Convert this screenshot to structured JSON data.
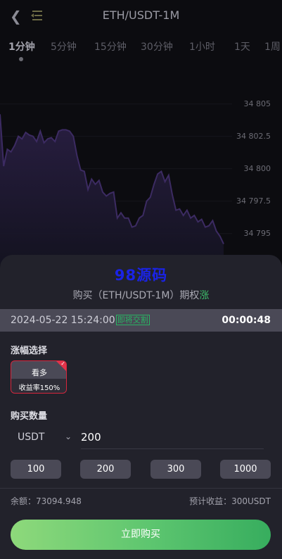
{
  "header": {
    "back_icon": "chevron-left-icon",
    "menu_icon": "menu-collapse-icon",
    "title": "ETH/USDT-1M"
  },
  "intervals": [
    "1分钟",
    "5分钟",
    "15分钟",
    "30分钟",
    "1小时",
    "1天",
    "1周"
  ],
  "active_interval": "1分钟",
  "chart_data": {
    "type": "area",
    "y_tick_labels": [
      "34 805",
      "34 802.5",
      "34 800",
      "34 797.5",
      "34 795"
    ],
    "ylim": [
      34792.6,
      34807.8
    ],
    "line_color": "#3c2b62",
    "values": [
      34804.2,
      34800.2,
      34801.5,
      34801.3,
      34801.8,
      34802.5,
      34802.3,
      34802.8,
      34802.6,
      34802.5,
      34802.1,
      34802.9,
      34802.0,
      34802.3,
      34802.4,
      34802.1,
      34802.9,
      34803.0,
      34803.0,
      34802.9,
      34802.5,
      34801.0,
      34799.9,
      34799.8,
      34798.4,
      34799.2,
      34798.8,
      34799.1,
      34798.2,
      34797.9,
      34798.1,
      34798.2,
      34796.2,
      34796.6,
      34796.2,
      34796.2,
      34795.5,
      34795.6,
      34796.2,
      34796.4,
      34797.5,
      34797.8,
      34798.8,
      34799.6,
      34799.8,
      34799.0,
      34799.5,
      34798.0,
      34796.8,
      34796.9,
      34796.4,
      34796.8,
      34796.2,
      34796.4,
      34795.9,
      34796.1,
      34795.5,
      34795.6,
      34796.0,
      34795.2,
      34794.8,
      34794.2
    ]
  },
  "watermark": "98源码",
  "order": {
    "buy_prefix": "购买（ETH/USDT-1M）期权",
    "direction": "涨",
    "datetime": "2024-05-22 15:24:00",
    "status_badge": "即将交割",
    "countdown": "00:00:48"
  },
  "rise_section": {
    "label": "涨幅选择",
    "option": {
      "name": "看多",
      "rate": "收益率150%",
      "selected": true
    }
  },
  "quantity": {
    "label": "购买数量",
    "currency": "USDT",
    "currency_icon": "chevron-down-icon",
    "amount": "200",
    "presets": [
      "100",
      "200",
      "300",
      "1000"
    ]
  },
  "summary": {
    "balance": "余额：73094.948",
    "expected": "预计收益：300USDT"
  },
  "buy_button": "立即购买",
  "colors": {
    "accent_green": "#3dbb6a",
    "danger_red": "#d7263d",
    "watermark_blue": "#1a23e6"
  }
}
